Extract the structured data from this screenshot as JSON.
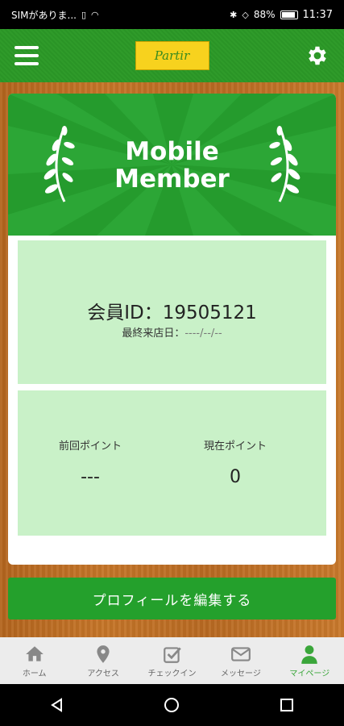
{
  "status_bar": {
    "carrier": "SIMがありま...",
    "battery": "88%",
    "time": "11:37"
  },
  "header": {
    "logo_text": "Partir",
    "menu_icon": "hamburger-icon",
    "settings_icon": "gear-icon"
  },
  "banner": {
    "title_line1": "Mobile",
    "title_line2": "Member"
  },
  "member": {
    "id_text": "会員ID：19505121",
    "last_visit_label": "最終来店日：",
    "last_visit_value": "----/--/--"
  },
  "points": {
    "previous_label": "前回ポイント",
    "previous_value": "---",
    "current_label": "現在ポイント",
    "current_value": "0"
  },
  "actions": {
    "edit_profile": "プロフィールを編集する"
  },
  "tabs": [
    {
      "label": "ホーム",
      "icon": "home-icon"
    },
    {
      "label": "アクセス",
      "icon": "map-pin-icon"
    },
    {
      "label": "チェックイン",
      "icon": "checkin-icon"
    },
    {
      "label": "メッセージ",
      "icon": "mail-icon"
    },
    {
      "label": "マイページ",
      "icon": "user-icon",
      "active": true
    }
  ],
  "colors": {
    "brand_green": "#259b2d",
    "panel_green": "#c9f1c8",
    "logo_yellow": "#f7d21e",
    "active_tab": "#3aa63a"
  }
}
